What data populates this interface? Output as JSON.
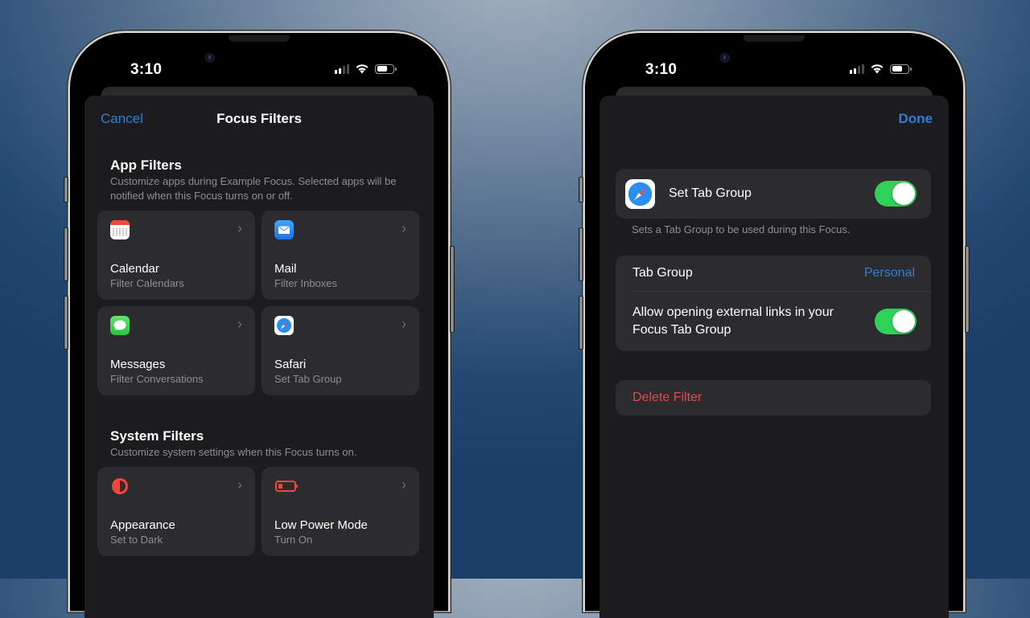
{
  "status_bar": {
    "time": "3:10"
  },
  "left_screen": {
    "nav": {
      "cancel_label": "Cancel",
      "title": "Focus Filters"
    },
    "app_filters": {
      "title": "App Filters",
      "description": "Customize apps during Example Focus. Selected apps will be notified when this Focus turns on or off.",
      "cards": [
        {
          "icon": "calendar-icon",
          "title": "Calendar",
          "subtitle": "Filter Calendars"
        },
        {
          "icon": "mail-icon",
          "title": "Mail",
          "subtitle": "Filter Inboxes"
        },
        {
          "icon": "messages-icon",
          "title": "Messages",
          "subtitle": "Filter Conversations"
        },
        {
          "icon": "safari-icon",
          "title": "Safari",
          "subtitle": "Set Tab Group"
        }
      ]
    },
    "system_filters": {
      "title": "System Filters",
      "description": "Customize system settings when this Focus turns on.",
      "cards": [
        {
          "icon": "appearance-icon",
          "title": "Appearance",
          "subtitle": "Set to Dark"
        },
        {
          "icon": "low-power-battery-icon",
          "title": "Low Power Mode",
          "subtitle": "Turn On"
        }
      ]
    }
  },
  "right_screen": {
    "nav": {
      "done_label": "Done"
    },
    "set_tab_group": {
      "label": "Set Tab Group",
      "enabled": true,
      "note": "Sets a Tab Group to be used during this Focus."
    },
    "tab_group": {
      "label": "Tab Group",
      "value": "Personal"
    },
    "external_links": {
      "label_line1": "Allow opening external links in your",
      "label_line2": "Focus Tab Group",
      "enabled": true
    },
    "delete_label": "Delete Filter"
  },
  "colors": {
    "accent_blue": "#2f7fd8",
    "destructive_red": "#e5484d",
    "toggle_green": "#30d158"
  }
}
